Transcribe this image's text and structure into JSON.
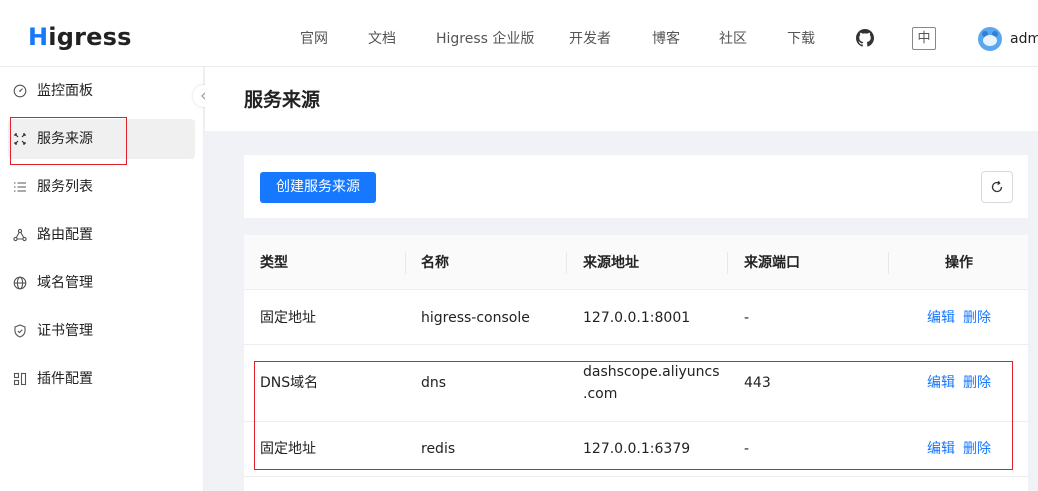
{
  "header": {
    "logo_text": "Higress",
    "nav": [
      "官网",
      "文档",
      "Higress 企业版",
      "开发者",
      "博客",
      "社区",
      "下载"
    ],
    "lang_label": "中",
    "user_name": "adm",
    "brand_color": "#1677ff"
  },
  "sidebar": {
    "items": [
      {
        "label": "监控面板",
        "icon": "dashboard-icon"
      },
      {
        "label": "服务来源",
        "icon": "service-source-icon",
        "active": true
      },
      {
        "label": "服务列表",
        "icon": "list-icon"
      },
      {
        "label": "路由配置",
        "icon": "route-icon"
      },
      {
        "label": "域名管理",
        "icon": "globe-icon"
      },
      {
        "label": "证书管理",
        "icon": "shield-icon"
      },
      {
        "label": "插件配置",
        "icon": "plugin-icon"
      }
    ]
  },
  "main": {
    "title": "服务来源",
    "create_button": "创建服务来源",
    "table": {
      "columns": [
        "类型",
        "名称",
        "来源地址",
        "来源端口",
        "操作"
      ],
      "rows": [
        {
          "type": "固定地址",
          "name": "higress-console",
          "address": "127.0.0.1:8001",
          "port": "-",
          "edit": "编辑",
          "delete": "删除"
        },
        {
          "type": "DNS域名",
          "name": "dns",
          "address": "dashscope.aliyuncs.com",
          "address_line1": "dashscope.aliyuncs",
          "address_line2": ".com",
          "port": "443",
          "edit": "编辑",
          "delete": "删除"
        },
        {
          "type": "固定地址",
          "name": "redis",
          "address": "127.0.0.1:6379",
          "port": "-",
          "edit": "编辑",
          "delete": "删除"
        }
      ]
    }
  },
  "annotation_color": "#e0212b"
}
